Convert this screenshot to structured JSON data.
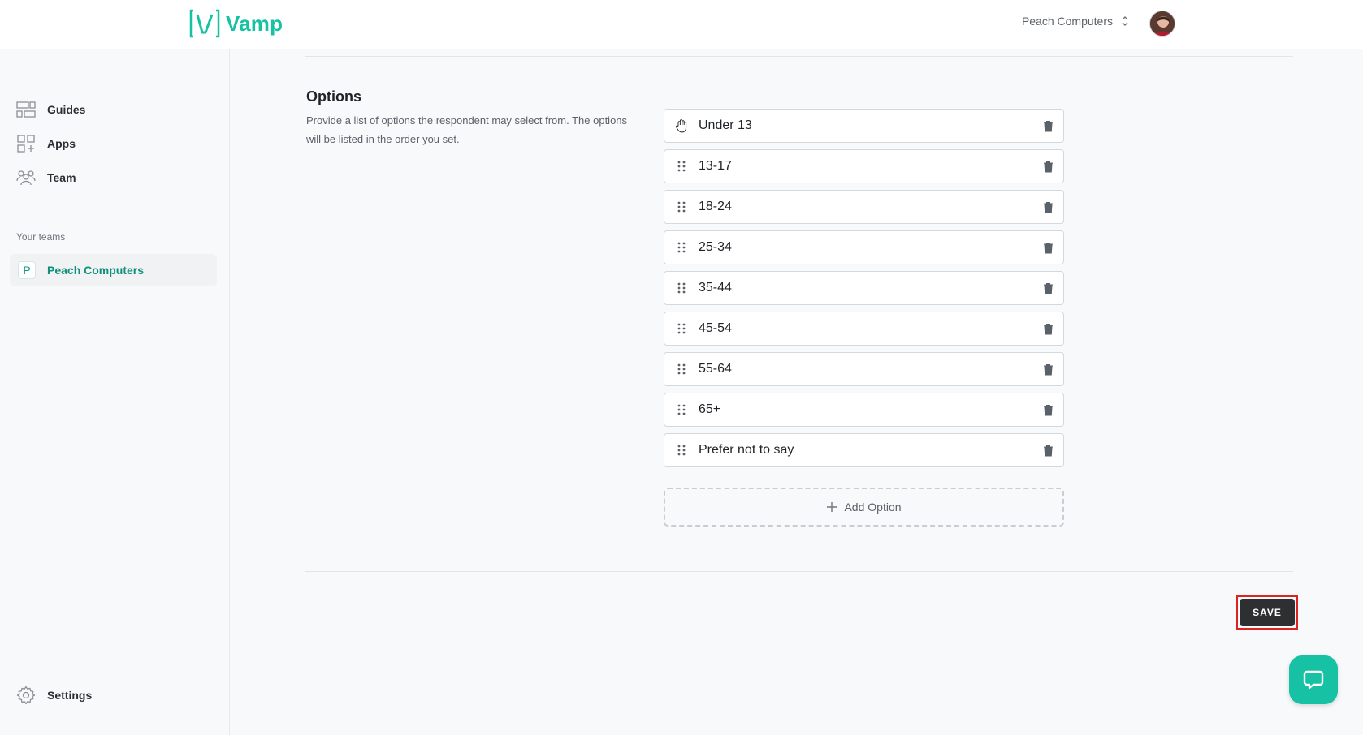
{
  "app": {
    "name": "Vamp",
    "brand_color": "#16c2a3"
  },
  "header": {
    "team_switcher_label": "Peach Computers"
  },
  "sidebar": {
    "items": [
      {
        "label": "Guides",
        "icon": "guides-icon"
      },
      {
        "label": "Apps",
        "icon": "apps-icon"
      },
      {
        "label": "Team",
        "icon": "team-icon"
      }
    ],
    "teams_section_label": "Your teams",
    "teams": [
      {
        "badge": "P",
        "name": "Peach Computers"
      }
    ],
    "settings_label": "Settings"
  },
  "main": {
    "options_title": "Options",
    "options_description": "Provide a list of options the respondent may select from. The options will be listed in the order you set.",
    "options": [
      "Under 13",
      "13-17",
      "18-24",
      "25-34",
      "35-44",
      "45-54",
      "55-64",
      "65+",
      "Prefer not to say"
    ],
    "add_option_label": "Add Option",
    "save_label": "SAVE"
  }
}
